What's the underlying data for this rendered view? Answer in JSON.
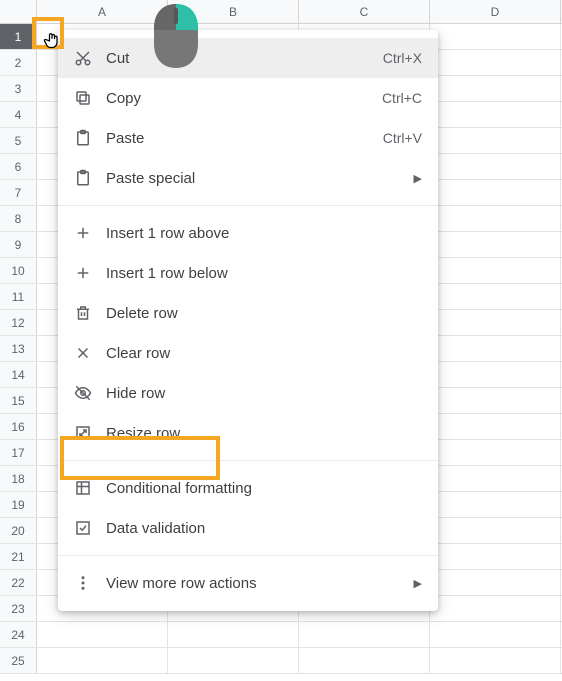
{
  "columns": [
    "A",
    "B",
    "C",
    "D"
  ],
  "rows": [
    1,
    2,
    3,
    4,
    5,
    6,
    7,
    8,
    9,
    10,
    11,
    12,
    13,
    14,
    15,
    16,
    17,
    18,
    19,
    20,
    21,
    22,
    23,
    24,
    25
  ],
  "menu": {
    "cut": "Cut",
    "cut_key": "Ctrl+X",
    "copy": "Copy",
    "copy_key": "Ctrl+C",
    "paste": "Paste",
    "paste_key": "Ctrl+V",
    "paste_special": "Paste special",
    "insert_above": "Insert 1 row above",
    "insert_below": "Insert 1 row below",
    "delete": "Delete row",
    "clear": "Clear row",
    "hide": "Hide row",
    "resize": "Resize row",
    "cond_format": "Conditional formatting",
    "data_valid": "Data validation",
    "more": "View more row actions"
  }
}
